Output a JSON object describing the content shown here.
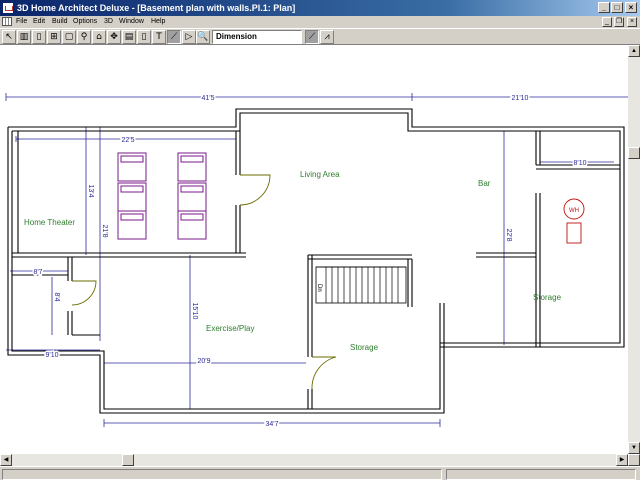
{
  "window": {
    "title": "3D Home Architect Deluxe - [Basement plan with walls.Pl.1: Plan]",
    "controls": {
      "minimize": "_",
      "maximize": "□",
      "close": "×"
    }
  },
  "menubar": {
    "items": [
      "File",
      "Edit",
      "Build",
      "Options",
      "3D",
      "Window",
      "Help"
    ],
    "mdi_controls": {
      "minimize": "_",
      "restore": "❐",
      "close": "×"
    }
  },
  "toolbar": {
    "mode_field": "Dimension",
    "tools": [
      "pointer-tool",
      "wall-tool",
      "door-tool",
      "window-tool",
      "cabinet-tool",
      "furniture-tool",
      "fixture-tool",
      "stairs-tool",
      "roof-tool",
      "electrical-tool",
      "text-tool",
      "dimension-tool",
      "arrow-tool",
      "zoom-tool"
    ],
    "right_tools": [
      "line-draw-tool",
      "point-to-point-tool"
    ],
    "icon_glyphs": [
      "↖",
      "▥",
      "▯",
      "⊞",
      "▢",
      "⚲",
      "⌂",
      "✥",
      "▤",
      "▯",
      "T",
      "⟋",
      "▷",
      "🔍"
    ]
  },
  "plan": {
    "dimensions": {
      "top_left": "41'5",
      "top_right": "21'10",
      "home_theater_width": "22'5",
      "left_height_a": "13'4",
      "left_height_b": "21'8",
      "bar_height": "22'8",
      "storage_right_width": "8'10",
      "small_room_width": "8'7",
      "small_room_height": "8'4",
      "bottom_left_width": "9'10",
      "exercise_height": "15'10",
      "exercise_width": "20'9",
      "bottom_total": "34'7"
    },
    "rooms": {
      "home_theater": "Home Theater",
      "living_area": "Living Area",
      "bar": "Bar",
      "exercise_play": "Exercise/Play",
      "storage_center": "Storage",
      "storage_right": "Storage"
    },
    "fixture_label": "WH",
    "stair_label": "Dn",
    "colors": {
      "wall": "#000000",
      "dimension": "#2a2a9a",
      "room_label": "#2e7d2e",
      "chair": "#7a1a8a",
      "fixture": "#c01010",
      "door_arc": "#6b6b00"
    }
  }
}
